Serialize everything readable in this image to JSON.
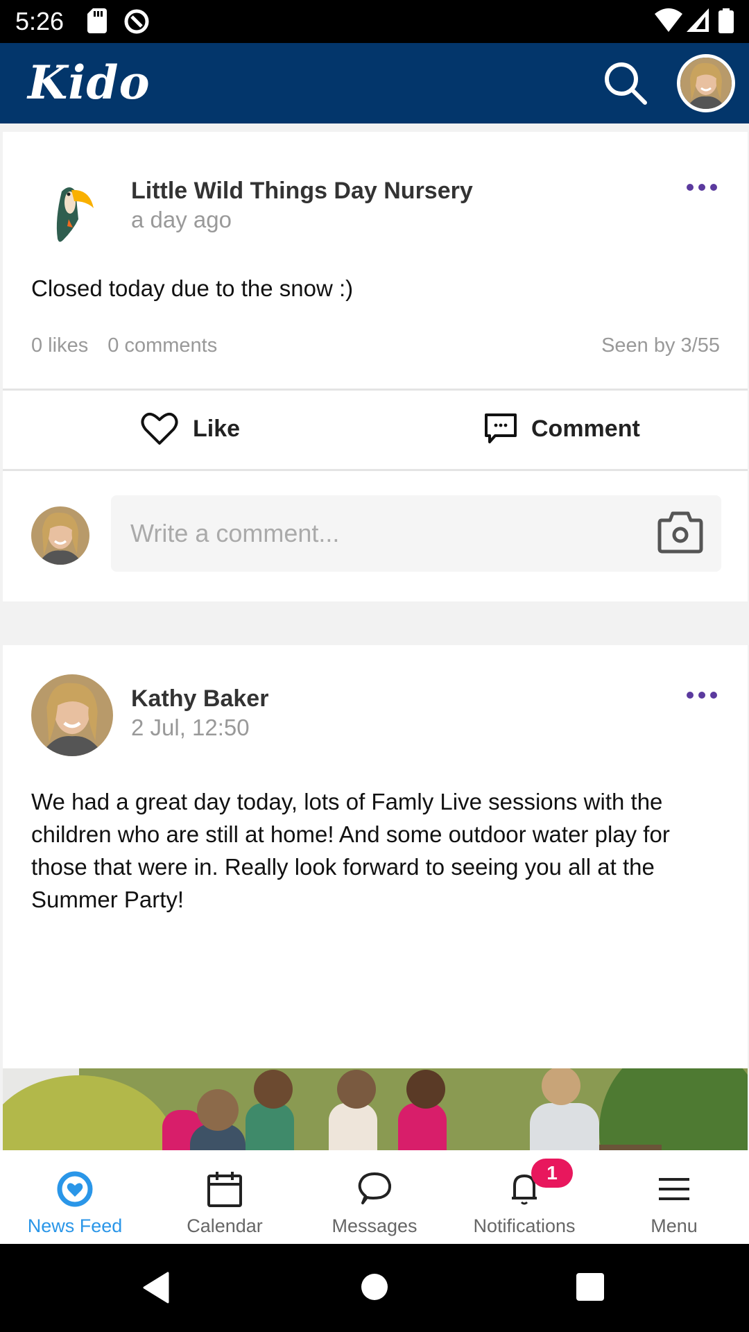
{
  "status_bar": {
    "time": "5:26",
    "left_icons": [
      "sd-card-icon",
      "data-saver-icon"
    ],
    "right_icons": [
      "wifi-icon",
      "cell-signal-icon",
      "battery-icon"
    ]
  },
  "header": {
    "logo": "Kido",
    "search_icon": "search-icon",
    "avatar_alt": "User profile"
  },
  "colors": {
    "header_bg": "#03366b",
    "accent_blue": "#2a96e8",
    "more_dots": "#5b3a9e",
    "badge": "#e8175d",
    "feed_bg": "#f2f2f2"
  },
  "posts": [
    {
      "author": "Little Wild Things Day Nursery",
      "time": "a day ago",
      "text": "Closed today due to the snow :)",
      "likes": "0 likes",
      "comments": "0 comments",
      "seen": "Seen by 3/55",
      "like_label": "Like",
      "comment_label": "Comment",
      "comment_placeholder": "Write a comment..."
    },
    {
      "author": "Kathy Baker",
      "time": "2 Jul, 12:50",
      "text": "We had a great day today, lots of Famly Live sessions with the children who are still at home! And some outdoor water play for those that were in. Really look forward to seeing you all at the Summer Party!"
    }
  ],
  "bottom_nav": {
    "items": [
      {
        "label": "News Feed",
        "icon": "news-feed-icon",
        "active": true
      },
      {
        "label": "Calendar",
        "icon": "calendar-icon"
      },
      {
        "label": "Messages",
        "icon": "chat-bubble-icon"
      },
      {
        "label": "Notifications",
        "icon": "bell-icon",
        "badge": "1"
      },
      {
        "label": "Menu",
        "icon": "hamburger-icon"
      }
    ]
  },
  "android_nav": [
    "back-icon",
    "home-icon",
    "recents-icon"
  ]
}
